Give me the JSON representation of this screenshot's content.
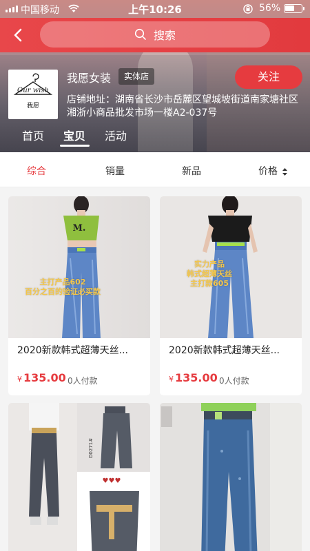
{
  "status_bar": {
    "carrier": "中国移动",
    "time": "上午10:26",
    "battery_percent": "56%"
  },
  "search": {
    "label": "搜索"
  },
  "store": {
    "name": "我愿女装",
    "badge": "实体店",
    "follow_label": "关注",
    "address": "店铺地址：湖南省长沙市岳麓区望城坡街道南家塘社区湘浙小商品批发市场一楼A2-037号",
    "logo_text": "Our wish",
    "logo_sub": "我愿",
    "tabs": [
      {
        "label": "首页"
      },
      {
        "label": "宝贝"
      },
      {
        "label": "活动"
      }
    ],
    "active_tab": "宝贝"
  },
  "sort_bar": {
    "items": [
      {
        "label": "综合"
      },
      {
        "label": "销量"
      },
      {
        "label": "新品"
      },
      {
        "label": "价格"
      }
    ],
    "active": "综合"
  },
  "products": [
    {
      "title": "2020新款韩式超薄天丝...",
      "currency": "¥",
      "price": "135.00",
      "sold": "0人付款",
      "image_caption_lines": [
        "主打产品602",
        "百分之百的验证必买款"
      ]
    },
    {
      "title": "2020新款韩式超薄天丝...",
      "currency": "¥",
      "price": "135.00",
      "sold": "0人付款",
      "image_caption_lines": [
        "实力产品",
        "韩式超薄天丝",
        "主打款605"
      ]
    },
    {
      "image_label": "D0271#"
    },
    {}
  ],
  "colors": {
    "accent_red": "#e63b3f",
    "background": "#f4f4f4"
  }
}
